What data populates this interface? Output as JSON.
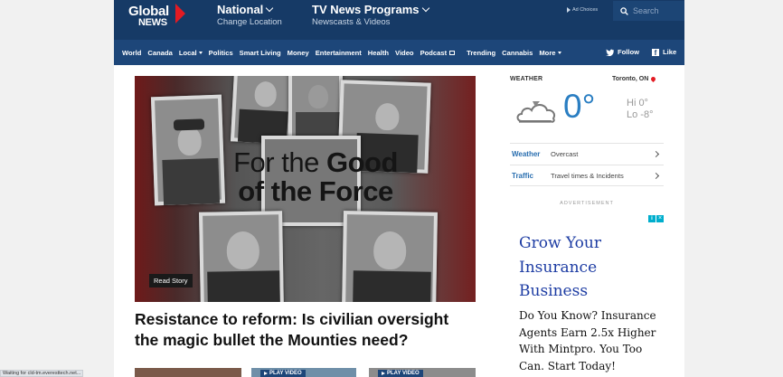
{
  "header": {
    "logo_line1": "Global",
    "logo_line2": "NEWS",
    "national": {
      "title": "National",
      "sub": "Change Location"
    },
    "tv": {
      "title": "TV News Programs",
      "sub": "Newscasts & Videos"
    },
    "adchoices": "Ad Choices",
    "search_placeholder": "Search"
  },
  "nav": {
    "items": [
      {
        "label": "World"
      },
      {
        "label": "Canada"
      },
      {
        "label": "Local",
        "dropdown": true
      },
      {
        "label": "Politics"
      },
      {
        "label": "Smart Living"
      },
      {
        "label": "Money"
      },
      {
        "label": "Entertainment"
      },
      {
        "label": "Health"
      },
      {
        "label": "Video"
      },
      {
        "label": "Podcast"
      }
    ],
    "items2": [
      {
        "label": "Trending"
      },
      {
        "label": "Cannabis"
      },
      {
        "label": "More",
        "dropdown": true
      }
    ],
    "follow": "Follow",
    "like": "Like"
  },
  "hero": {
    "title_light": "For the",
    "title_bold1": "Good",
    "title_bold2": "of the Force",
    "read_story": "Read Story",
    "headline": "Resistance to reform: Is civilian oversight the magic bullet the Mounties need?"
  },
  "thumbs": {
    "play_video": "PLAY VIDEO"
  },
  "weather": {
    "label": "WEATHER",
    "location": "Toronto, ON",
    "temp": "0°",
    "hi": "Hi 0°",
    "lo": "Lo -8°",
    "rows": [
      {
        "key": "Weather",
        "value": "Overcast"
      },
      {
        "key": "Traffic",
        "value": "Travel times & Incidents"
      }
    ]
  },
  "ad": {
    "label": "ADVERTISEMENT",
    "headline_lines": [
      "Grow Your",
      "Insurance",
      "Business"
    ],
    "body": "Do You Know? Insurance Agents Earn 2.5x Higher With Mintpro. You Too Can. Start Today!"
  },
  "status": "Waiting for cld-tm.everesttech.net..."
}
